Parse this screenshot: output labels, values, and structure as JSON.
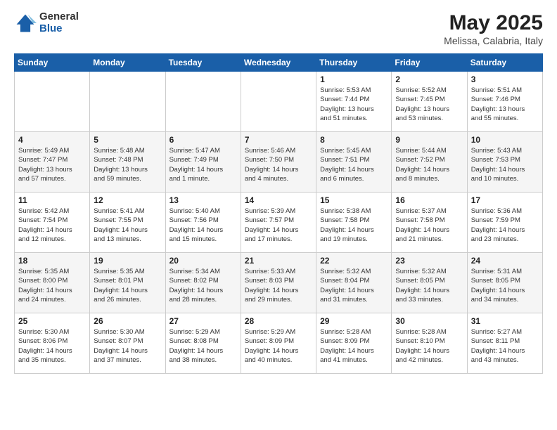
{
  "header": {
    "logo_general": "General",
    "logo_blue": "Blue",
    "title": "May 2025",
    "location": "Melissa, Calabria, Italy"
  },
  "calendar": {
    "days_of_week": [
      "Sunday",
      "Monday",
      "Tuesday",
      "Wednesday",
      "Thursday",
      "Friday",
      "Saturday"
    ],
    "weeks": [
      [
        {
          "day": "",
          "info": ""
        },
        {
          "day": "",
          "info": ""
        },
        {
          "day": "",
          "info": ""
        },
        {
          "day": "",
          "info": ""
        },
        {
          "day": "1",
          "info": "Sunrise: 5:53 AM\nSunset: 7:44 PM\nDaylight: 13 hours\nand 51 minutes."
        },
        {
          "day": "2",
          "info": "Sunrise: 5:52 AM\nSunset: 7:45 PM\nDaylight: 13 hours\nand 53 minutes."
        },
        {
          "day": "3",
          "info": "Sunrise: 5:51 AM\nSunset: 7:46 PM\nDaylight: 13 hours\nand 55 minutes."
        }
      ],
      [
        {
          "day": "4",
          "info": "Sunrise: 5:49 AM\nSunset: 7:47 PM\nDaylight: 13 hours\nand 57 minutes."
        },
        {
          "day": "5",
          "info": "Sunrise: 5:48 AM\nSunset: 7:48 PM\nDaylight: 13 hours\nand 59 minutes."
        },
        {
          "day": "6",
          "info": "Sunrise: 5:47 AM\nSunset: 7:49 PM\nDaylight: 14 hours\nand 1 minute."
        },
        {
          "day": "7",
          "info": "Sunrise: 5:46 AM\nSunset: 7:50 PM\nDaylight: 14 hours\nand 4 minutes."
        },
        {
          "day": "8",
          "info": "Sunrise: 5:45 AM\nSunset: 7:51 PM\nDaylight: 14 hours\nand 6 minutes."
        },
        {
          "day": "9",
          "info": "Sunrise: 5:44 AM\nSunset: 7:52 PM\nDaylight: 14 hours\nand 8 minutes."
        },
        {
          "day": "10",
          "info": "Sunrise: 5:43 AM\nSunset: 7:53 PM\nDaylight: 14 hours\nand 10 minutes."
        }
      ],
      [
        {
          "day": "11",
          "info": "Sunrise: 5:42 AM\nSunset: 7:54 PM\nDaylight: 14 hours\nand 12 minutes."
        },
        {
          "day": "12",
          "info": "Sunrise: 5:41 AM\nSunset: 7:55 PM\nDaylight: 14 hours\nand 13 minutes."
        },
        {
          "day": "13",
          "info": "Sunrise: 5:40 AM\nSunset: 7:56 PM\nDaylight: 14 hours\nand 15 minutes."
        },
        {
          "day": "14",
          "info": "Sunrise: 5:39 AM\nSunset: 7:57 PM\nDaylight: 14 hours\nand 17 minutes."
        },
        {
          "day": "15",
          "info": "Sunrise: 5:38 AM\nSunset: 7:58 PM\nDaylight: 14 hours\nand 19 minutes."
        },
        {
          "day": "16",
          "info": "Sunrise: 5:37 AM\nSunset: 7:58 PM\nDaylight: 14 hours\nand 21 minutes."
        },
        {
          "day": "17",
          "info": "Sunrise: 5:36 AM\nSunset: 7:59 PM\nDaylight: 14 hours\nand 23 minutes."
        }
      ],
      [
        {
          "day": "18",
          "info": "Sunrise: 5:35 AM\nSunset: 8:00 PM\nDaylight: 14 hours\nand 24 minutes."
        },
        {
          "day": "19",
          "info": "Sunrise: 5:35 AM\nSunset: 8:01 PM\nDaylight: 14 hours\nand 26 minutes."
        },
        {
          "day": "20",
          "info": "Sunrise: 5:34 AM\nSunset: 8:02 PM\nDaylight: 14 hours\nand 28 minutes."
        },
        {
          "day": "21",
          "info": "Sunrise: 5:33 AM\nSunset: 8:03 PM\nDaylight: 14 hours\nand 29 minutes."
        },
        {
          "day": "22",
          "info": "Sunrise: 5:32 AM\nSunset: 8:04 PM\nDaylight: 14 hours\nand 31 minutes."
        },
        {
          "day": "23",
          "info": "Sunrise: 5:32 AM\nSunset: 8:05 PM\nDaylight: 14 hours\nand 33 minutes."
        },
        {
          "day": "24",
          "info": "Sunrise: 5:31 AM\nSunset: 8:05 PM\nDaylight: 14 hours\nand 34 minutes."
        }
      ],
      [
        {
          "day": "25",
          "info": "Sunrise: 5:30 AM\nSunset: 8:06 PM\nDaylight: 14 hours\nand 35 minutes."
        },
        {
          "day": "26",
          "info": "Sunrise: 5:30 AM\nSunset: 8:07 PM\nDaylight: 14 hours\nand 37 minutes."
        },
        {
          "day": "27",
          "info": "Sunrise: 5:29 AM\nSunset: 8:08 PM\nDaylight: 14 hours\nand 38 minutes."
        },
        {
          "day": "28",
          "info": "Sunrise: 5:29 AM\nSunset: 8:09 PM\nDaylight: 14 hours\nand 40 minutes."
        },
        {
          "day": "29",
          "info": "Sunrise: 5:28 AM\nSunset: 8:09 PM\nDaylight: 14 hours\nand 41 minutes."
        },
        {
          "day": "30",
          "info": "Sunrise: 5:28 AM\nSunset: 8:10 PM\nDaylight: 14 hours\nand 42 minutes."
        },
        {
          "day": "31",
          "info": "Sunrise: 5:27 AM\nSunset: 8:11 PM\nDaylight: 14 hours\nand 43 minutes."
        }
      ]
    ]
  }
}
